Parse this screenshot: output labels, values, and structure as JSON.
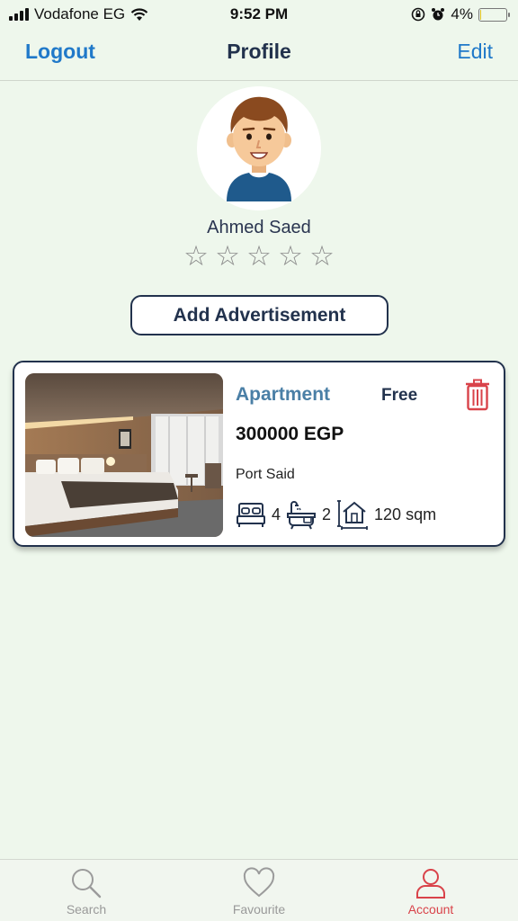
{
  "status_bar": {
    "carrier": "Vodafone EG",
    "time": "9:52 PM",
    "battery": "4%",
    "battery_level": 0.04
  },
  "nav": {
    "left_label": "Logout",
    "title": "Profile",
    "right_label": "Edit"
  },
  "profile": {
    "name": "Ahmed Saed",
    "rating": 0,
    "max_rating": 5,
    "star_glyph": "☆"
  },
  "add_ad_label": "Add Advertisement",
  "listing": {
    "type": "Apartment",
    "status": "Free",
    "price": "300000 EGP",
    "location": "Port Said",
    "bedrooms": "4",
    "bathrooms": "2",
    "area": "120 sqm",
    "icons": [
      "bed-icon",
      "bathtub-icon",
      "house-area-icon",
      "trash-icon"
    ]
  },
  "tabs": [
    {
      "label": "Search",
      "icon": "search-icon"
    },
    {
      "label": "Favourite",
      "icon": "heart-icon"
    },
    {
      "label": "Account",
      "icon": "user-icon",
      "active": true
    }
  ],
  "colors": {
    "background": "#eef7ec",
    "link": "#2079c9",
    "navy": "#22324d",
    "accent_red": "#d9434a",
    "type_blue": "#4a7fa6"
  }
}
